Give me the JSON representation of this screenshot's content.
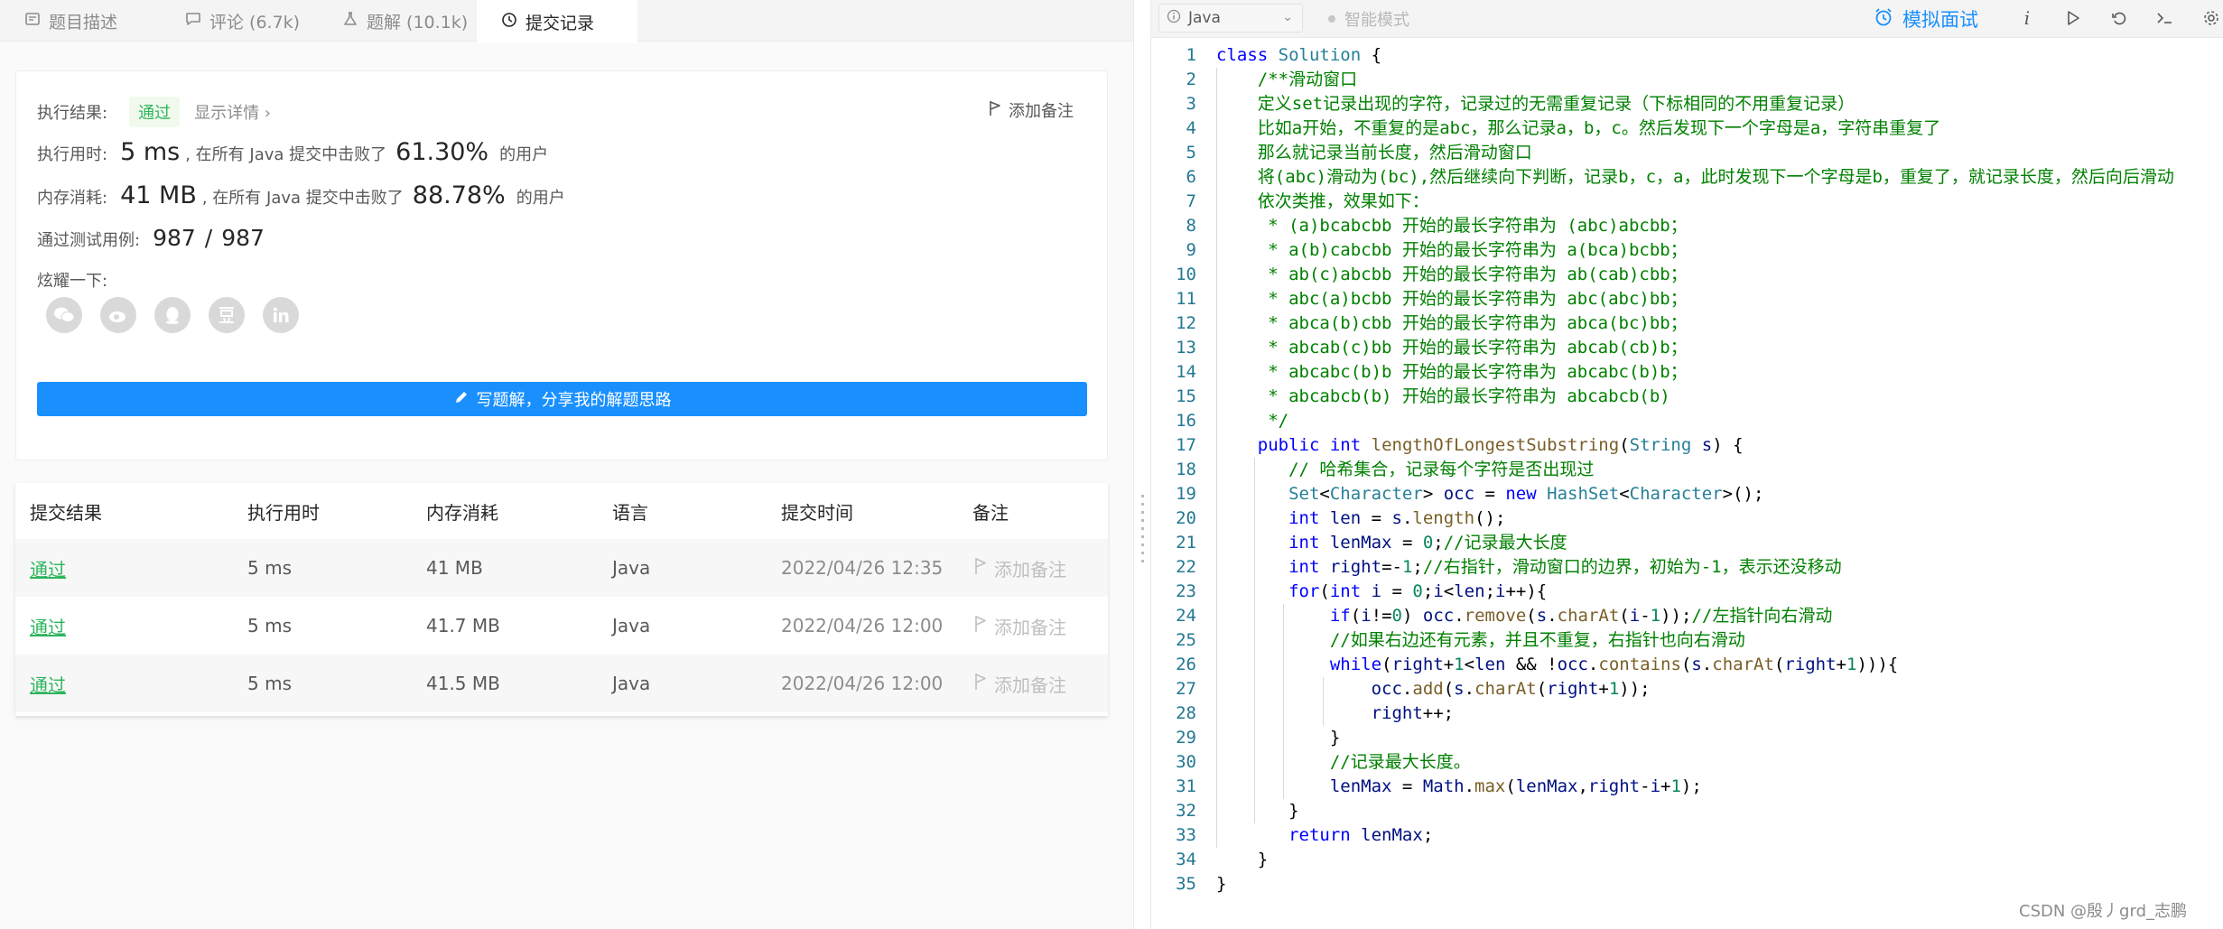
{
  "tabs": [
    {
      "label": "题目描述",
      "icon": "document-icon"
    },
    {
      "label": "评论 (6.7k)",
      "icon": "comment-icon"
    },
    {
      "label": "题解 (10.1k)",
      "icon": "flask-icon"
    },
    {
      "label": "提交记录",
      "icon": "clock-icon"
    }
  ],
  "result": {
    "status_label": "执行结果:",
    "status_value": "通过",
    "detail_link": "显示详情 ›",
    "add_note": "添加备注",
    "time_label": "执行用时:",
    "time_value": "5 ms",
    "time_mid": ", 在所有 Java 提交中击败了",
    "time_pct": "61.30%",
    "time_suffix": "的用户",
    "mem_label": "内存消耗:",
    "mem_value": "41 MB",
    "mem_mid": ", 在所有 Java 提交中击败了",
    "mem_pct": "88.78%",
    "mem_suffix": "的用户",
    "cases_label": "通过测试用例:",
    "cases_passed": "987",
    "cases_sep": "/",
    "cases_total": "987",
    "share_label": "炫耀一下:",
    "share_icons": [
      "wechat-icon",
      "weibo-icon",
      "qq-icon",
      "douban-icon",
      "linkedin-icon"
    ],
    "write_button": "写题解，分享我的解题思路"
  },
  "table": {
    "headers": [
      "提交结果",
      "执行用时",
      "内存消耗",
      "语言",
      "提交时间",
      "备注"
    ],
    "rows": [
      {
        "result": "通过",
        "time": "5 ms",
        "memory": "41 MB",
        "lang": "Java",
        "submitted": "2022/04/26 12:35",
        "note": "添加备注"
      },
      {
        "result": "通过",
        "time": "5 ms",
        "memory": "41.7 MB",
        "lang": "Java",
        "submitted": "2022/04/26 12:00",
        "note": "添加备注"
      },
      {
        "result": "通过",
        "time": "5 ms",
        "memory": "41.5 MB",
        "lang": "Java",
        "submitted": "2022/04/26 12:00",
        "note": "添加备注"
      }
    ]
  },
  "editor_toolbar": {
    "language": "Java",
    "smart_mode": "智能模式",
    "mock_interview": "模拟面试"
  },
  "code_lines": [
    [
      [
        "k",
        "class"
      ],
      [
        "p",
        " "
      ],
      [
        "t",
        "Solution"
      ],
      [
        "p",
        " {"
      ]
    ],
    [
      [
        "p",
        "    "
      ],
      [
        "c",
        "/**滑动窗口"
      ]
    ],
    [
      [
        "p",
        "    "
      ],
      [
        "c",
        "定义set记录出现的字符，记录过的无需重复记录（下标相同的不用重复记录）"
      ]
    ],
    [
      [
        "p",
        "    "
      ],
      [
        "c",
        "比如a开始，不重复的是abc，那么记录a，b，c。然后发现下一个字母是a，字符串重复了"
      ]
    ],
    [
      [
        "p",
        "    "
      ],
      [
        "c",
        "那么就记录当前长度，然后滑动窗口"
      ]
    ],
    [
      [
        "p",
        "    "
      ],
      [
        "c",
        "将(abc)滑动为(bc),然后继续向下判断，记录b，c，a，此时发现下一个字母是b，重复了，就记录长度，然后向后滑动"
      ]
    ],
    [
      [
        "p",
        "    "
      ],
      [
        "c",
        "依次类推，效果如下："
      ]
    ],
    [
      [
        "p",
        "    "
      ],
      [
        "c",
        " * (a)bcabcbb 开始的最长字符串为 (abc)abcbb；"
      ]
    ],
    [
      [
        "p",
        "    "
      ],
      [
        "c",
        " * a(b)cabcbb 开始的最长字符串为 a(bca)bcbb；"
      ]
    ],
    [
      [
        "p",
        "    "
      ],
      [
        "c",
        " * ab(c)abcbb 开始的最长字符串为 ab(cab)cbb；"
      ]
    ],
    [
      [
        "p",
        "    "
      ],
      [
        "c",
        " * abc(a)bcbb 开始的最长字符串为 abc(abc)bb；"
      ]
    ],
    [
      [
        "p",
        "    "
      ],
      [
        "c",
        " * abca(b)cbb 开始的最长字符串为 abca(bc)bb；"
      ]
    ],
    [
      [
        "p",
        "    "
      ],
      [
        "c",
        " * abcab(c)bb 开始的最长字符串为 abcab(cb)b；"
      ]
    ],
    [
      [
        "p",
        "    "
      ],
      [
        "c",
        " * abcabc(b)b 开始的最长字符串为 abcabc(b)b；"
      ]
    ],
    [
      [
        "p",
        "    "
      ],
      [
        "c",
        " * abcabcb(b) 开始的最长字符串为 abcabcb(b)"
      ]
    ],
    [
      [
        "p",
        "    "
      ],
      [
        "c",
        " */"
      ]
    ],
    [
      [
        "p",
        "    "
      ],
      [
        "k",
        "public"
      ],
      [
        "p",
        " "
      ],
      [
        "k",
        "int"
      ],
      [
        "p",
        " "
      ],
      [
        "m",
        "lengthOfLongestSubstring"
      ],
      [
        "p",
        "("
      ],
      [
        "t",
        "String"
      ],
      [
        "p",
        " "
      ],
      [
        "v",
        "s"
      ],
      [
        "p",
        ") {"
      ]
    ],
    [
      [
        "p",
        "       "
      ],
      [
        "c",
        "// 哈希集合，记录每个字符是否出现过"
      ]
    ],
    [
      [
        "p",
        "       "
      ],
      [
        "t",
        "Set"
      ],
      [
        "p",
        "<"
      ],
      [
        "t",
        "Character"
      ],
      [
        "p",
        "> "
      ],
      [
        "v",
        "occ"
      ],
      [
        "p",
        " = "
      ],
      [
        "k",
        "new"
      ],
      [
        "p",
        " "
      ],
      [
        "t",
        "HashSet"
      ],
      [
        "p",
        "<"
      ],
      [
        "t",
        "Character"
      ],
      [
        "p",
        ">();"
      ]
    ],
    [
      [
        "p",
        "       "
      ],
      [
        "k",
        "int"
      ],
      [
        "p",
        " "
      ],
      [
        "v",
        "len"
      ],
      [
        "p",
        " = "
      ],
      [
        "v",
        "s"
      ],
      [
        "p",
        "."
      ],
      [
        "m",
        "length"
      ],
      [
        "p",
        "();"
      ]
    ],
    [
      [
        "p",
        "       "
      ],
      [
        "k",
        "int"
      ],
      [
        "p",
        " "
      ],
      [
        "v",
        "lenMax"
      ],
      [
        "p",
        " = "
      ],
      [
        "n",
        "0"
      ],
      [
        "p",
        ";"
      ],
      [
        "c",
        "//记录最大长度"
      ]
    ],
    [
      [
        "p",
        "       "
      ],
      [
        "k",
        "int"
      ],
      [
        "p",
        " "
      ],
      [
        "v",
        "right"
      ],
      [
        "p",
        "=-"
      ],
      [
        "n",
        "1"
      ],
      [
        "p",
        ";"
      ],
      [
        "c",
        "//右指针，滑动窗口的边界，初始为-1，表示还没移动"
      ]
    ],
    [
      [
        "p",
        "       "
      ],
      [
        "k",
        "for"
      ],
      [
        "p",
        "("
      ],
      [
        "k",
        "int"
      ],
      [
        "p",
        " "
      ],
      [
        "v",
        "i"
      ],
      [
        "p",
        " = "
      ],
      [
        "n",
        "0"
      ],
      [
        "p",
        ";"
      ],
      [
        "v",
        "i"
      ],
      [
        "p",
        "<"
      ],
      [
        "v",
        "len"
      ],
      [
        "p",
        ";"
      ],
      [
        "v",
        "i"
      ],
      [
        "p",
        "++){"
      ]
    ],
    [
      [
        "p",
        "           "
      ],
      [
        "k",
        "if"
      ],
      [
        "p",
        "("
      ],
      [
        "v",
        "i"
      ],
      [
        "p",
        "!="
      ],
      [
        "n",
        "0"
      ],
      [
        "p",
        ") "
      ],
      [
        "v",
        "occ"
      ],
      [
        "p",
        "."
      ],
      [
        "m",
        "remove"
      ],
      [
        "p",
        "("
      ],
      [
        "v",
        "s"
      ],
      [
        "p",
        "."
      ],
      [
        "m",
        "charAt"
      ],
      [
        "p",
        "("
      ],
      [
        "v",
        "i"
      ],
      [
        "p",
        "-"
      ],
      [
        "n",
        "1"
      ],
      [
        "p",
        "));"
      ],
      [
        "c",
        "//左指针向右滑动"
      ]
    ],
    [
      [
        "p",
        "           "
      ],
      [
        "c",
        "//如果右边还有元素，并且不重复，右指针也向右滑动"
      ]
    ],
    [
      [
        "p",
        "           "
      ],
      [
        "k",
        "while"
      ],
      [
        "p",
        "("
      ],
      [
        "v",
        "right"
      ],
      [
        "p",
        "+"
      ],
      [
        "n",
        "1"
      ],
      [
        "p",
        "<"
      ],
      [
        "v",
        "len"
      ],
      [
        "p",
        " && !"
      ],
      [
        "v",
        "occ"
      ],
      [
        "p",
        "."
      ],
      [
        "m",
        "contains"
      ],
      [
        "p",
        "("
      ],
      [
        "v",
        "s"
      ],
      [
        "p",
        "."
      ],
      [
        "m",
        "charAt"
      ],
      [
        "p",
        "("
      ],
      [
        "v",
        "right"
      ],
      [
        "p",
        "+"
      ],
      [
        "n",
        "1"
      ],
      [
        "p",
        "))){"
      ]
    ],
    [
      [
        "p",
        "               "
      ],
      [
        "v",
        "occ"
      ],
      [
        "p",
        "."
      ],
      [
        "m",
        "add"
      ],
      [
        "p",
        "("
      ],
      [
        "v",
        "s"
      ],
      [
        "p",
        "."
      ],
      [
        "m",
        "charAt"
      ],
      [
        "p",
        "("
      ],
      [
        "v",
        "right"
      ],
      [
        "p",
        "+"
      ],
      [
        "n",
        "1"
      ],
      [
        "p",
        "));"
      ]
    ],
    [
      [
        "p",
        "               "
      ],
      [
        "v",
        "right"
      ],
      [
        "p",
        "++;"
      ]
    ],
    [
      [
        "p",
        "           }"
      ]
    ],
    [
      [
        "p",
        "           "
      ],
      [
        "c",
        "//记录最大长度。"
      ]
    ],
    [
      [
        "p",
        "           "
      ],
      [
        "v",
        "lenMax"
      ],
      [
        "p",
        " = "
      ],
      [
        "v",
        "Math"
      ],
      [
        "p",
        "."
      ],
      [
        "m",
        "max"
      ],
      [
        "p",
        "("
      ],
      [
        "v",
        "lenMax"
      ],
      [
        "p",
        ","
      ],
      [
        "v",
        "right"
      ],
      [
        "p",
        "-"
      ],
      [
        "v",
        "i"
      ],
      [
        "p",
        "+"
      ],
      [
        "n",
        "1"
      ],
      [
        "p",
        ");"
      ]
    ],
    [
      [
        "p",
        "       }"
      ]
    ],
    [
      [
        "p",
        "       "
      ],
      [
        "k",
        "return"
      ],
      [
        "p",
        " "
      ],
      [
        "v",
        "lenMax"
      ],
      [
        "p",
        ";"
      ]
    ],
    [
      [
        "p",
        "    }"
      ]
    ],
    [
      [
        "p",
        "}"
      ]
    ]
  ],
  "watermark": "CSDN @殷丿grd_志鹏",
  "colors": {
    "accent": "#1a90ff",
    "success": "#2db55d",
    "keyword": "#0000ff",
    "comment": "#008000",
    "line_number": "#237893"
  }
}
